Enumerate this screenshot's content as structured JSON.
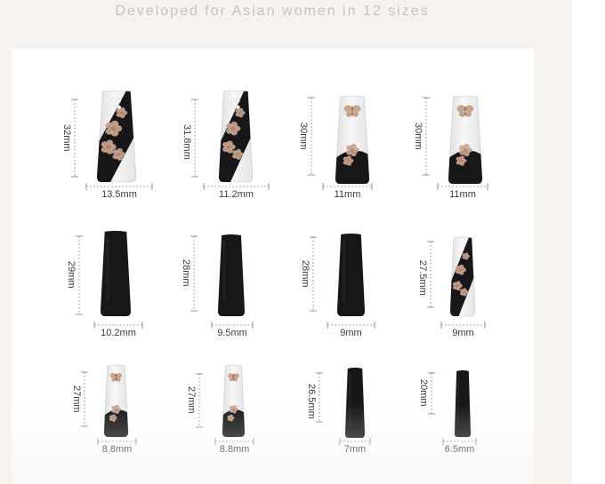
{
  "headline": "Developed for Asian women in 12 sizes",
  "colors": {
    "background": "#f6f2ee",
    "panel": "#ffffff",
    "nail_black": "#17171a",
    "nail_clear": "#ebebeb",
    "flower": "#c9a48c",
    "guide_line": "#8a8a8a"
  },
  "nails": [
    {
      "length": "32mm",
      "width": "13.5mm",
      "design": "clear-black-diagonal-flowers-pearls"
    },
    {
      "length": "31.8mm",
      "width": "11.2mm",
      "design": "clear-black-diagonal-flowers-pearls"
    },
    {
      "length": "30mm",
      "width": "11mm",
      "design": "clear-butterfly-pearls-black-tip"
    },
    {
      "length": "30mm",
      "width": "11mm",
      "design": "clear-butterfly-pearls-black-tip"
    },
    {
      "length": "29mm",
      "width": "10.2mm",
      "design": "solid-matte-black"
    },
    {
      "length": "28mm",
      "width": "9.5mm",
      "design": "solid-matte-black"
    },
    {
      "length": "28mm",
      "width": "9mm",
      "design": "solid-matte-black"
    },
    {
      "length": "27.5mm",
      "width": "9mm",
      "design": "clear-black-diagonal-flowers"
    },
    {
      "length": "27mm",
      "width": "8.8mm",
      "design": "clear-butterfly-black-tip"
    },
    {
      "length": "27mm",
      "width": "8.8mm",
      "design": "clear-butterfly-black-tip"
    },
    {
      "length": "26.5mm",
      "width": "7mm",
      "design": "solid-matte-black"
    },
    {
      "length": "20mm",
      "width": "6.5mm",
      "design": "solid-matte-black"
    }
  ]
}
